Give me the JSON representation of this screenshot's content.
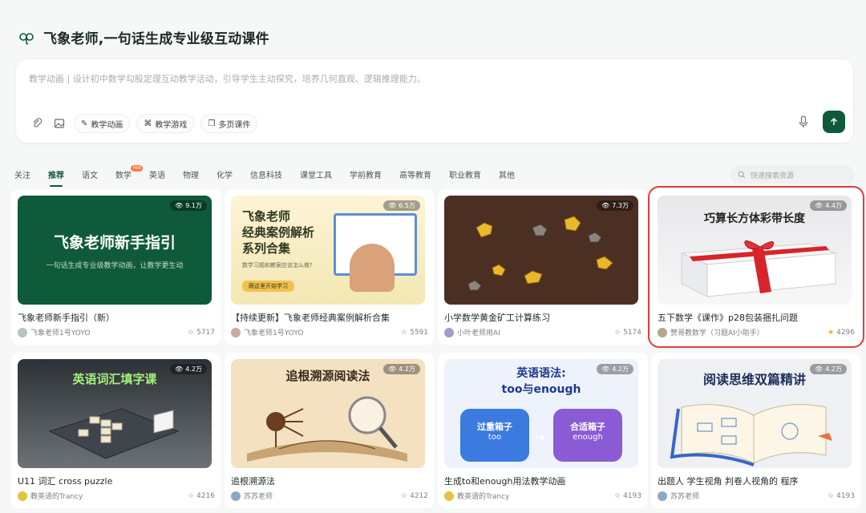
{
  "header": {
    "title": "飞象老师,一句话生成专业级互动课件"
  },
  "prompt": {
    "placeholder": "教学动画 | 设计初中数学勾股定理互动教学活动，引导学生主动探究，培养几何直观、逻辑推理能力。"
  },
  "chips": [
    {
      "label": "教学动画",
      "icon": "teach-animation-icon"
    },
    {
      "label": "教学游戏",
      "icon": "game-icon"
    },
    {
      "label": "多页课件",
      "icon": "slides-icon"
    }
  ],
  "tabs": [
    {
      "label": "关注"
    },
    {
      "label": "推荐",
      "active": true
    },
    {
      "label": "语文"
    },
    {
      "label": "数学",
      "badge": "Hot"
    },
    {
      "label": "英语"
    },
    {
      "label": "物理"
    },
    {
      "label": "化学"
    },
    {
      "label": "信息科技"
    },
    {
      "label": "课堂工具"
    },
    {
      "label": "学前教育"
    },
    {
      "label": "高等教育"
    },
    {
      "label": "职业教育"
    },
    {
      "label": "其他"
    }
  ],
  "search": {
    "placeholder": "快速搜索资源"
  },
  "cards": [
    {
      "title": "飞象老师新手指引（新）",
      "views": "9.1万",
      "author": "飞象老师1号YOYO",
      "likes": "5717",
      "thumb_title": "飞象老师新手指引",
      "thumb_sub": "一句话生成专业级教学动画，让教学更生动"
    },
    {
      "title": "【持续更新】飞象老师经典案例解析合集",
      "views": "6.5万",
      "author": "飞象老师1号YOYO",
      "likes": "5591",
      "thumb_title": "飞象老师\n经典案例解析\n系列合集",
      "thumb_sub": "数学习题和教案应该怎么做?",
      "thumb_btn": "跟这里开始学习"
    },
    {
      "title": "小学数学黄金矿工计算练习",
      "views": "7.3万",
      "author": "小叶老师用AI",
      "likes": "5174"
    },
    {
      "title": "五下数学《课作》p28包装捆扎问题",
      "views": "4.4万",
      "author": "赞哥教数学（习题AI小助手）",
      "likes": "4296",
      "thumb_title": "巧算长方体彩带长度",
      "selected": true
    },
    {
      "title": "U11 词汇 cross puzzle",
      "views": "4.2万",
      "author": "教英语的Trancy",
      "likes": "4216",
      "thumb_title": "英语词汇填字课"
    },
    {
      "title": "追根溯源法",
      "views": "4.2万",
      "author": "苏苏老师",
      "likes": "4212",
      "thumb_title": "追根溯源阅读法"
    },
    {
      "title": "生成to和enough用法教学动画",
      "views": "4.2万",
      "author": "教英语的Trancy",
      "likes": "4193",
      "thumb_title": "英语语法:\ntoo与enough",
      "thumb_left": "过重箱子",
      "thumb_left_sub": "too",
      "thumb_right": "合适箱子",
      "thumb_right_sub": "enough"
    },
    {
      "title": "出题人 学生视角 判卷人视角的 程序",
      "views": "4.2万",
      "author": "苏苏老师",
      "likes": "4193",
      "thumb_title": "阅读思维双篇精讲"
    }
  ],
  "colors": {
    "brand": "#0f5a3b",
    "selection": "#e53d3d"
  }
}
